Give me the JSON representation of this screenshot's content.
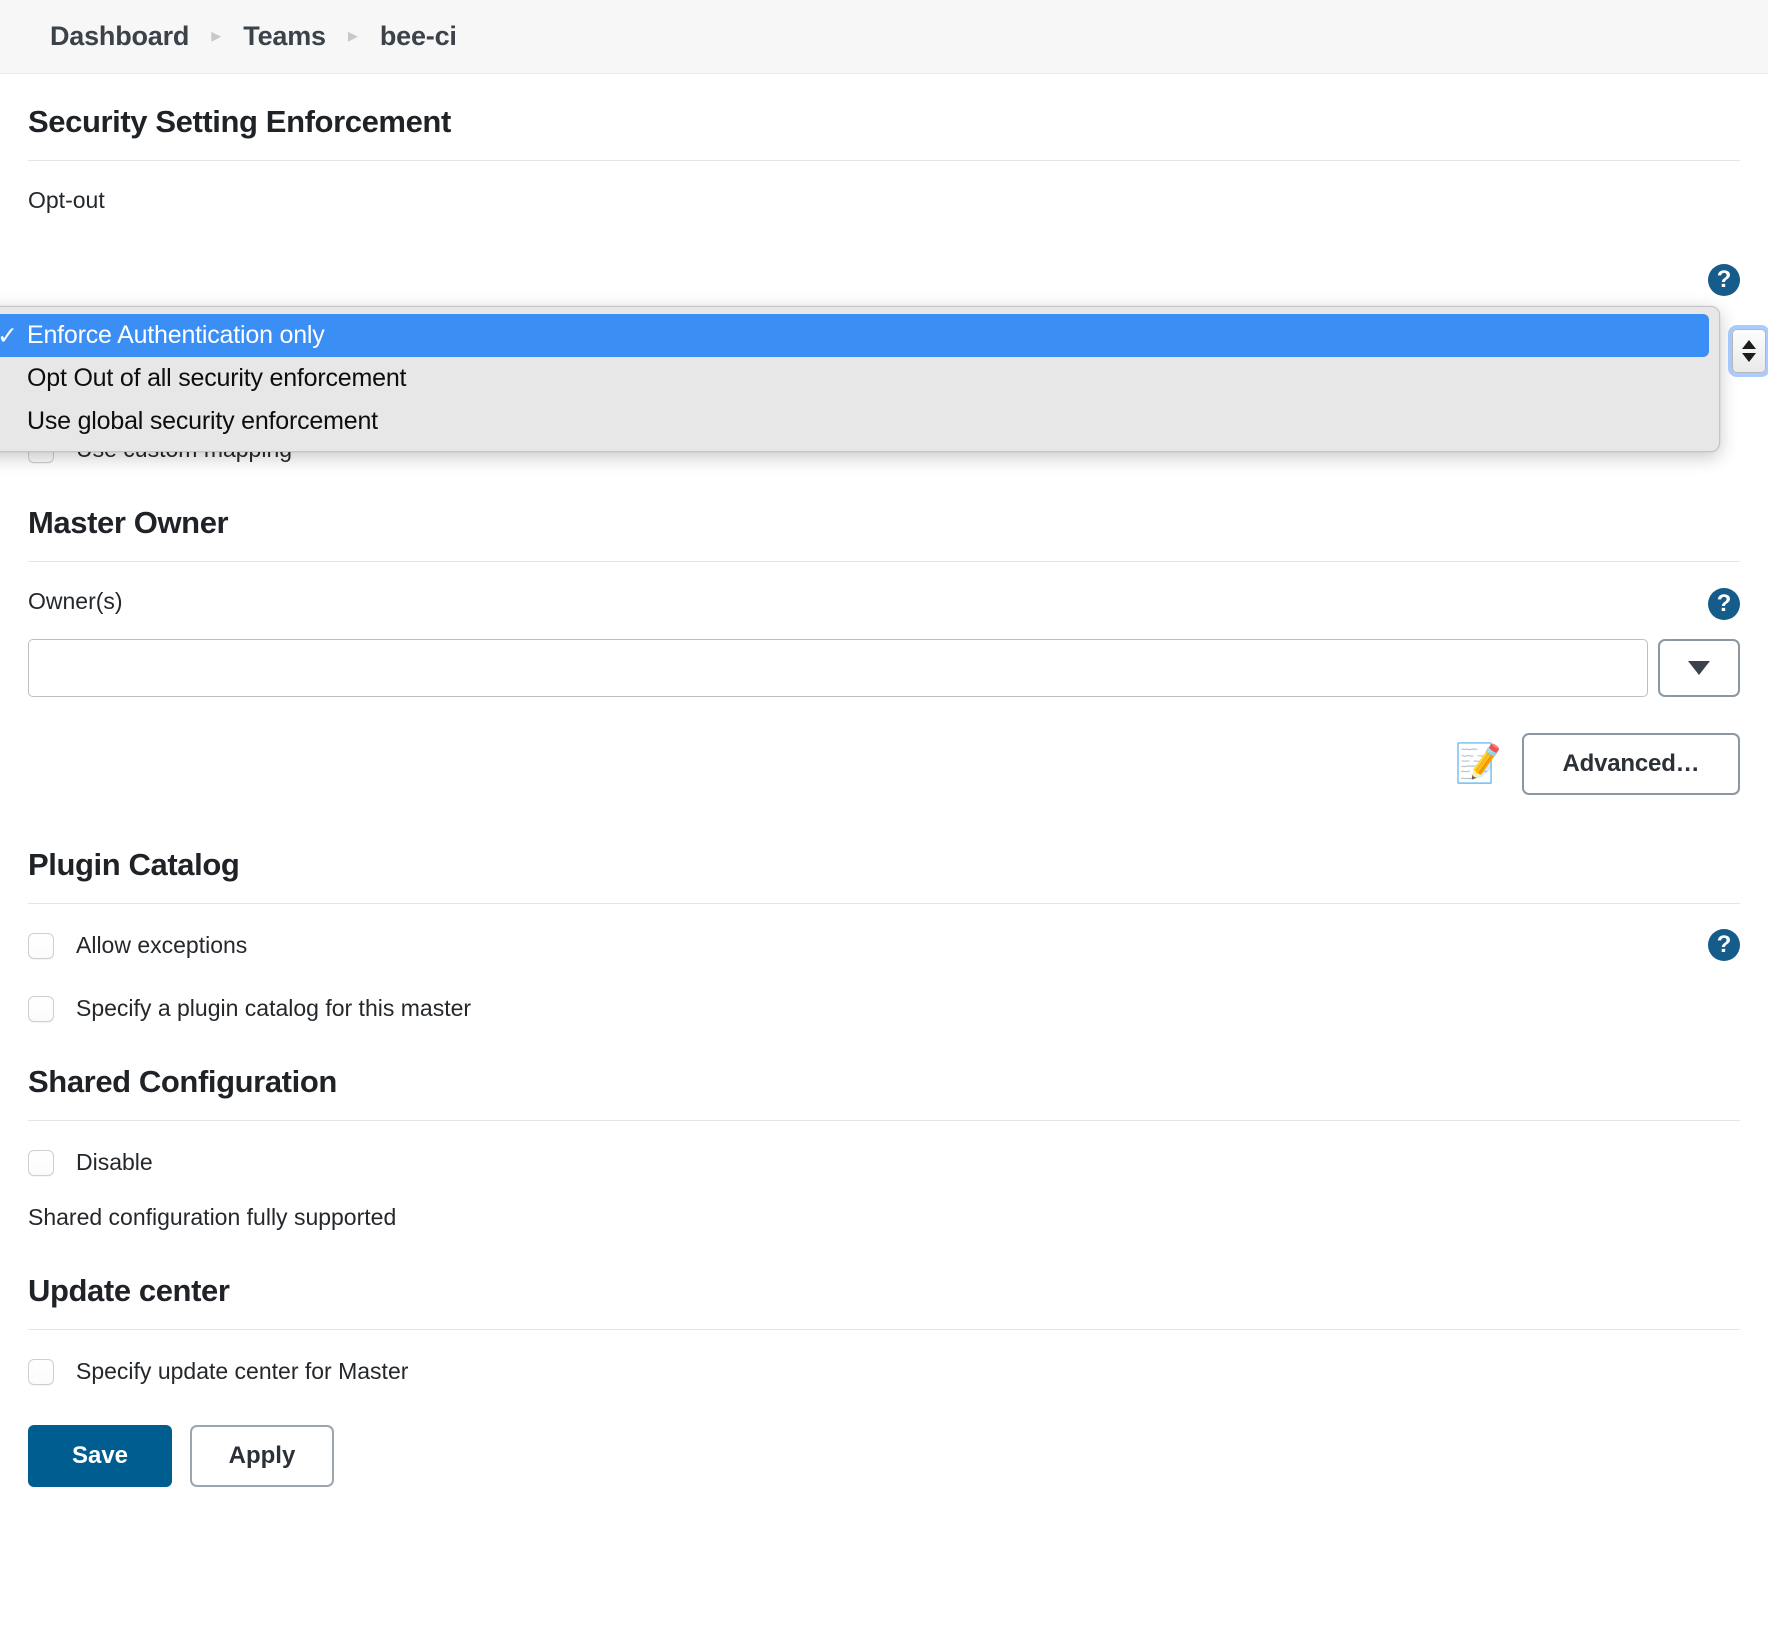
{
  "breadcrumb": {
    "items": [
      {
        "label": "Dashboard"
      },
      {
        "label": "Teams"
      },
      {
        "label": "bee-ci"
      }
    ],
    "separator": "▸"
  },
  "security_section": {
    "title": "Security Setting Enforcement",
    "opt_out_label": "Opt-out",
    "help_glyph": "?",
    "dropdown": {
      "selected": "Enforce Authentication only",
      "check_glyph": "✓",
      "options": [
        "Enforce Authentication only",
        "Opt Out of all security enforcement",
        "Use global security enforcement"
      ]
    },
    "custom_mapping_label": "Use custom mapping"
  },
  "master_owner": {
    "title": "Master Owner",
    "owners_label": "Owner(s)",
    "help_glyph": "?",
    "owners_value": "",
    "owners_placeholder": "",
    "dropdown_glyph": "▼",
    "notepad_icon": "📝",
    "advanced_label": "Advanced…"
  },
  "plugin_catalog": {
    "title": "Plugin Catalog",
    "help_glyph": "?",
    "allow_exceptions_label": "Allow exceptions",
    "specify_catalog_label": "Specify a plugin catalog for this master"
  },
  "shared_configuration": {
    "title": "Shared Configuration",
    "disable_label": "Disable",
    "status_text": "Shared configuration fully supported"
  },
  "update_center": {
    "title": "Update center",
    "specify_label": "Specify update center for Master"
  },
  "footer": {
    "save_label": "Save",
    "apply_label": "Apply"
  },
  "colors": {
    "accent_blue": "#005d8f",
    "help_blue": "#165c8a",
    "selection_blue": "#3b8ef3",
    "breadcrumb_bg": "#f7f7f8"
  }
}
